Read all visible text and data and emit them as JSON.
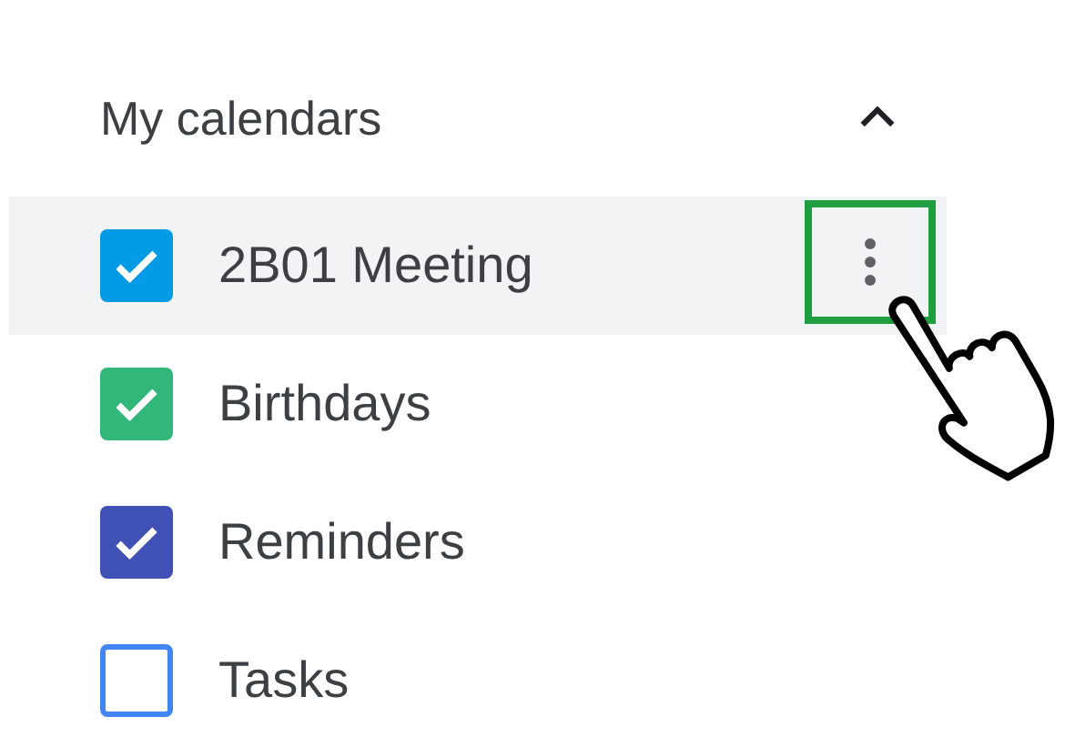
{
  "section": {
    "title": "My calendars",
    "expanded": true
  },
  "calendars": [
    {
      "label": "2B01 Meeting",
      "checked": true,
      "color": "#039be5",
      "hovered": true
    },
    {
      "label": "Birthdays",
      "checked": true,
      "color": "#33b679",
      "hovered": false
    },
    {
      "label": "Reminders",
      "checked": true,
      "color": "#3f51b5",
      "hovered": false
    },
    {
      "label": "Tasks",
      "checked": false,
      "color": "#4285f4",
      "hovered": false
    }
  ]
}
